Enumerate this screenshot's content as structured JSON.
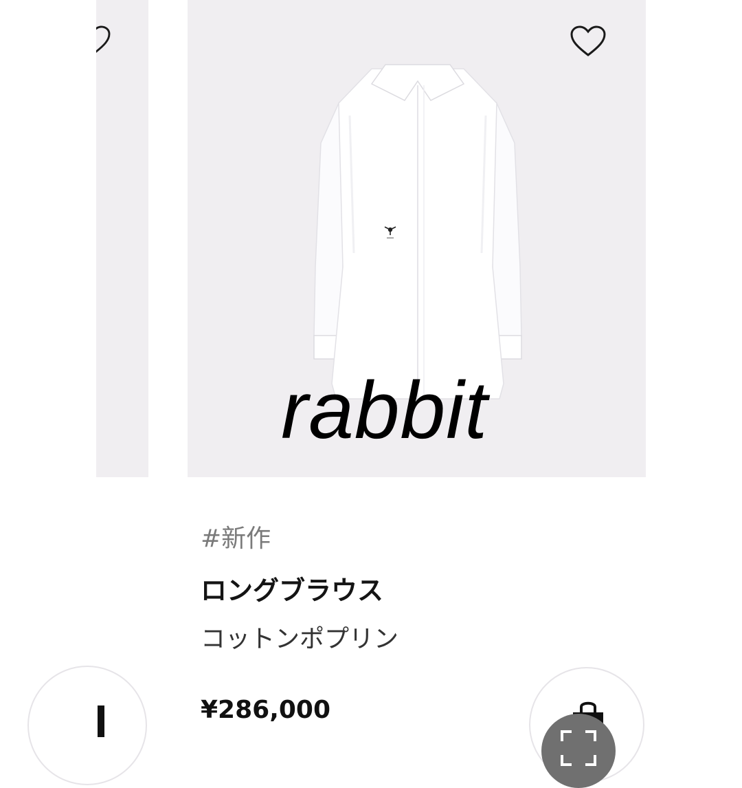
{
  "product": {
    "tag": "#新作",
    "name": "ロングブラウス",
    "subtitle": "コットンポプリン",
    "price": "¥286,000",
    "image_watermark": "rabbit"
  },
  "icons": {
    "favorite": "heart-icon",
    "cart": "shopping-bag-icon",
    "scan": "scan-icon"
  },
  "colors": {
    "card_background": "#f0eef1",
    "text_primary": "#141414",
    "text_secondary": "#7a7a7a",
    "scan_button": "#707070"
  }
}
